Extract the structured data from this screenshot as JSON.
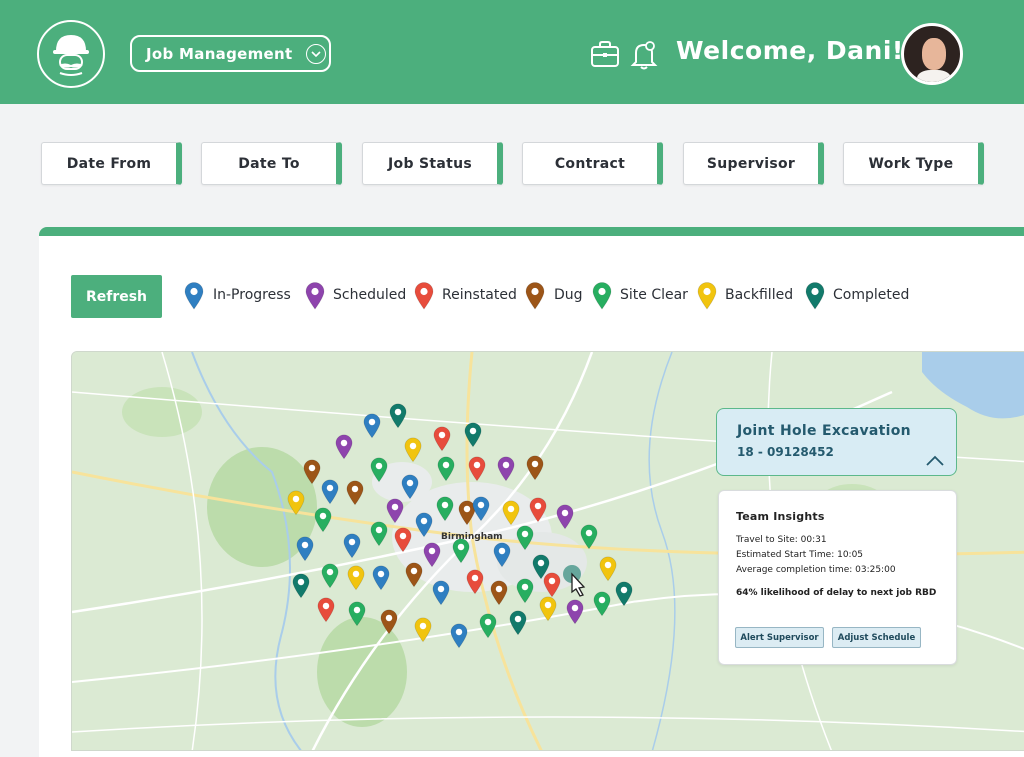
{
  "header": {
    "nav_label": "Job Management",
    "welcome": "Welcome, Dani!"
  },
  "filters": [
    "Date From",
    "Date To",
    "Job Status",
    "Contract",
    "Supervisor",
    "Work Type"
  ],
  "toolbar": {
    "refresh_label": "Refresh"
  },
  "legend": [
    {
      "label": "In-Progress",
      "color": "#2f7fc1"
    },
    {
      "label": "Scheduled",
      "color": "#8e44ad"
    },
    {
      "label": "Reinstated",
      "color": "#e74c3c"
    },
    {
      "label": "Dug",
      "color": "#9c5518"
    },
    {
      "label": "Site Clear",
      "color": "#27ae60"
    },
    {
      "label": "Backfilled",
      "color": "#f1c40f"
    },
    {
      "label": "Completed",
      "color": "#127a6b"
    }
  ],
  "map": {
    "city_label": "Birmingham"
  },
  "job_card": {
    "title": "Joint Hole Excavation",
    "job_ref": "18 - 09128452"
  },
  "insights": {
    "heading": "Team Insights",
    "travel": "Travel to Site: 00:31",
    "start": "Estimated Start Time: 10:05",
    "completion": "Average completion time: 03:25:00",
    "risk": "64% likelihood of delay to next job RBD",
    "alert_button": "Alert Supervisor",
    "adjust_button": "Adjust Schedule"
  }
}
